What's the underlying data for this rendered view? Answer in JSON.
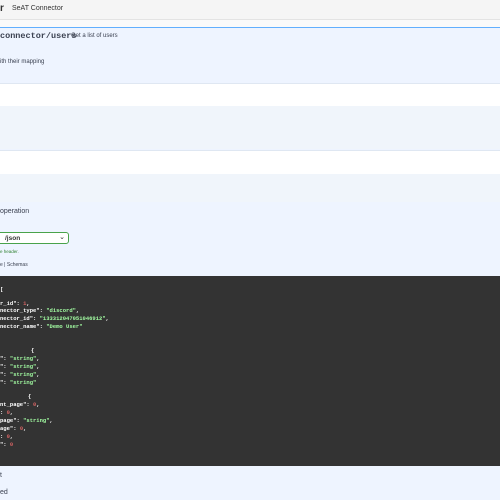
{
  "topbar": {
    "icon": "swagger-logo-icon",
    "icon_glyph": "r",
    "title": "SeAT Connector"
  },
  "operation": {
    "path": "connector/users",
    "summary": "Get a list of users",
    "description": "ith their mapping",
    "label": "operation",
    "content_type": "/json",
    "content_hint": "e header.",
    "tabs": "e | Schemas",
    "footer_1": "t",
    "footer_2": "ed"
  },
  "code": {
    "lines": [
      "[",
      "r_id\": 1,",
      "nector_type\": \"discord\",",
      "nector_id\": \"133312047051046912\",",
      "nector_name\": \"Demo User\"",
      "",
      "",
      "{",
      "\": \"string\",",
      "\": \"string\",",
      "\": \"string\",",
      "\": \"string\"",
      "",
      "{",
      "nt_page\": 0,",
      ": 0,",
      "page\": \"string\",",
      "age\": 0,",
      ": 0,",
      "\": 0"
    ]
  }
}
